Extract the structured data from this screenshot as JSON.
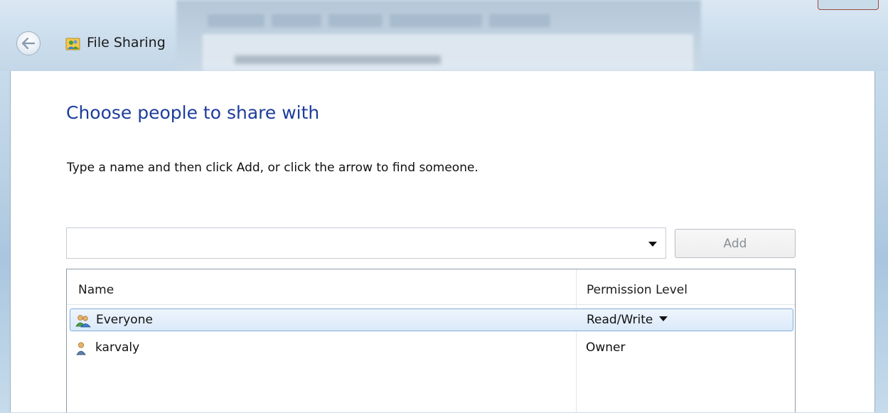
{
  "window": {
    "title": "File Sharing"
  },
  "main": {
    "heading": "Choose people to share with",
    "instruction": "Type a name and then click Add, or click the arrow to find someone."
  },
  "name_input": {
    "value": "",
    "placeholder": ""
  },
  "add_button": {
    "label": "Add",
    "enabled": false
  },
  "list": {
    "columns": [
      "Name",
      "Permission Level"
    ],
    "rows": [
      {
        "name": "Everyone",
        "permission": "Read/Write",
        "icon": "group-users-icon",
        "selected": true,
        "has_dropdown": true
      },
      {
        "name": "karvaly",
        "permission": "Owner",
        "icon": "user-icon",
        "selected": false,
        "has_dropdown": false
      }
    ]
  },
  "colors": {
    "heading": "#1e3d9c",
    "selection_border": "#84acdd",
    "glass": "#c9dcec"
  }
}
